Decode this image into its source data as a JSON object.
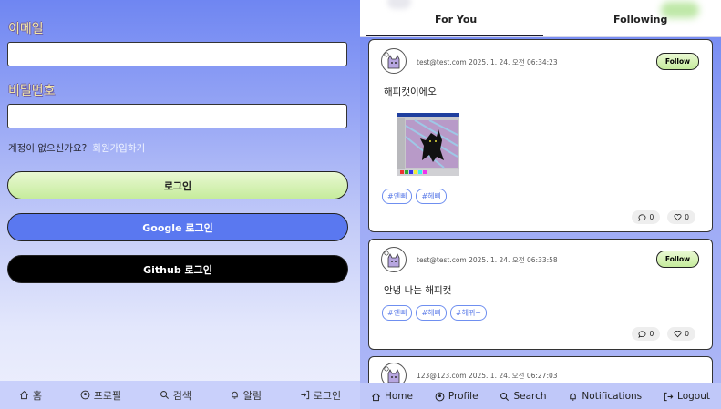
{
  "login": {
    "email_label": "이메일",
    "password_label": "비밀번호",
    "no_account_text": "계정이 없으신가요?",
    "signup_link": "회원가입하기",
    "login_button": "로그인",
    "google_button": "Google 로그인",
    "github_button": "Github 로그인"
  },
  "left_nav": {
    "home": "홈",
    "profile": "프로필",
    "search": "검색",
    "notifications": "알림",
    "login": "로그인"
  },
  "feed": {
    "tabs": [
      "For You",
      "Following"
    ],
    "posts": [
      {
        "author": "test@test.com",
        "date": "2025. 1. 24. 오전 06:34:23",
        "follow_label": "Follow",
        "content": "해피캣이에오",
        "tags": [
          "#엔삐",
          "#헤삐"
        ],
        "comments": "0",
        "likes": "0"
      },
      {
        "author": "test@test.com",
        "date": "2025. 1. 24. 오전 06:33:58",
        "follow_label": "Follow",
        "content": "안녕 나는 해피캣",
        "tags": [
          "#엔삐",
          "#헤삐",
          "#헤뀌~"
        ],
        "comments": "0",
        "likes": "0"
      },
      {
        "author": "123@123.com",
        "date": "2025. 1. 24. 오전 06:27:03"
      }
    ]
  },
  "right_nav": {
    "home": "Home",
    "profile": "Profile",
    "search": "Search",
    "notifications": "Notifications",
    "logout": "Logout"
  },
  "colors": {
    "accent_blue": "#5a78f0",
    "follow_green": "#c6ec9c",
    "tag_blue": "#6f8ff0"
  }
}
